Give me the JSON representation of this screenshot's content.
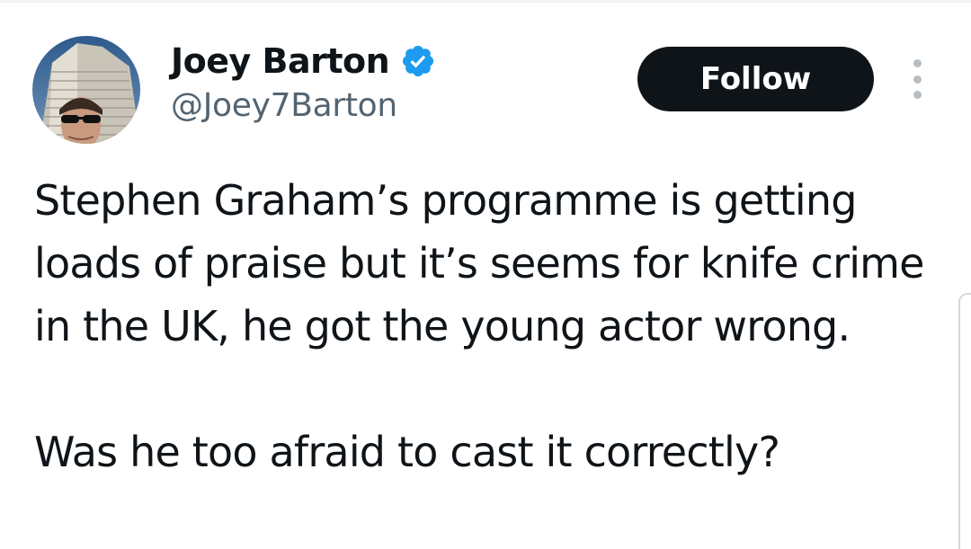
{
  "author": {
    "display_name": "Joey Barton",
    "handle": "@Joey7Barton",
    "verified_icon": "verified-badge-icon",
    "avatar_icon": "profile-photo"
  },
  "actions": {
    "follow_label": "Follow",
    "more_icon": "more-options-icon"
  },
  "tweet": {
    "paragraph_1": "Stephen Graham’s programme is getting loads of praise but it’s seems for knife crime in the UK, he got the young actor wrong.",
    "paragraph_2": "Was he too afraid to cast it correctly?"
  },
  "colors": {
    "text": "#0f1419",
    "handle": "#536471",
    "verified": "#1d9bf0",
    "follow_bg": "#0f1419",
    "follow_text": "#ffffff"
  }
}
